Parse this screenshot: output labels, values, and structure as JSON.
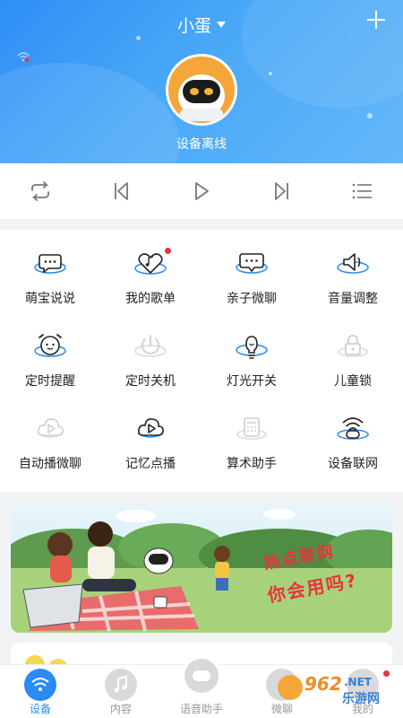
{
  "header": {
    "device_name": "小蛋",
    "status": "设备离线"
  },
  "controls": {
    "items": [
      {
        "icon": "repeat-icon"
      },
      {
        "icon": "previous-icon"
      },
      {
        "icon": "play-icon"
      },
      {
        "icon": "next-icon"
      },
      {
        "icon": "playlist-icon"
      }
    ]
  },
  "grid": {
    "items": [
      {
        "label": "萌宝说说",
        "icon": "chat-bubble-icon"
      },
      {
        "label": "我的歌单",
        "icon": "heart-music-icon",
        "badge": true
      },
      {
        "label": "亲子微聊",
        "icon": "message-icon"
      },
      {
        "label": "音量调整",
        "icon": "volume-icon"
      },
      {
        "label": "定时提醒",
        "icon": "alarm-icon"
      },
      {
        "label": "定时关机",
        "icon": "power-icon"
      },
      {
        "label": "灯光开关",
        "icon": "lightbulb-icon"
      },
      {
        "label": "儿童锁",
        "icon": "lock-icon"
      },
      {
        "label": "自动播微聊",
        "icon": "auto-play-icon"
      },
      {
        "label": "记忆点播",
        "icon": "memory-play-icon"
      },
      {
        "label": "算术助手",
        "icon": "calculator-icon"
      },
      {
        "label": "设备联网",
        "icon": "wifi-device-icon"
      }
    ]
  },
  "banner": {
    "line1": "热点联网",
    "line2": "你会用吗?"
  },
  "nav": {
    "items": [
      {
        "label": "设备",
        "active": true
      },
      {
        "label": "内容"
      },
      {
        "label": "语音助手"
      },
      {
        "label": "微聊"
      },
      {
        "label": "我的"
      }
    ]
  },
  "watermark": {
    "text1": "962",
    "text2": ".NET",
    "text3": "乐游网"
  },
  "colors": {
    "primary": "#2b8bf2",
    "accent_red": "#e8333a",
    "avatar_bg": "#f4a63a"
  }
}
